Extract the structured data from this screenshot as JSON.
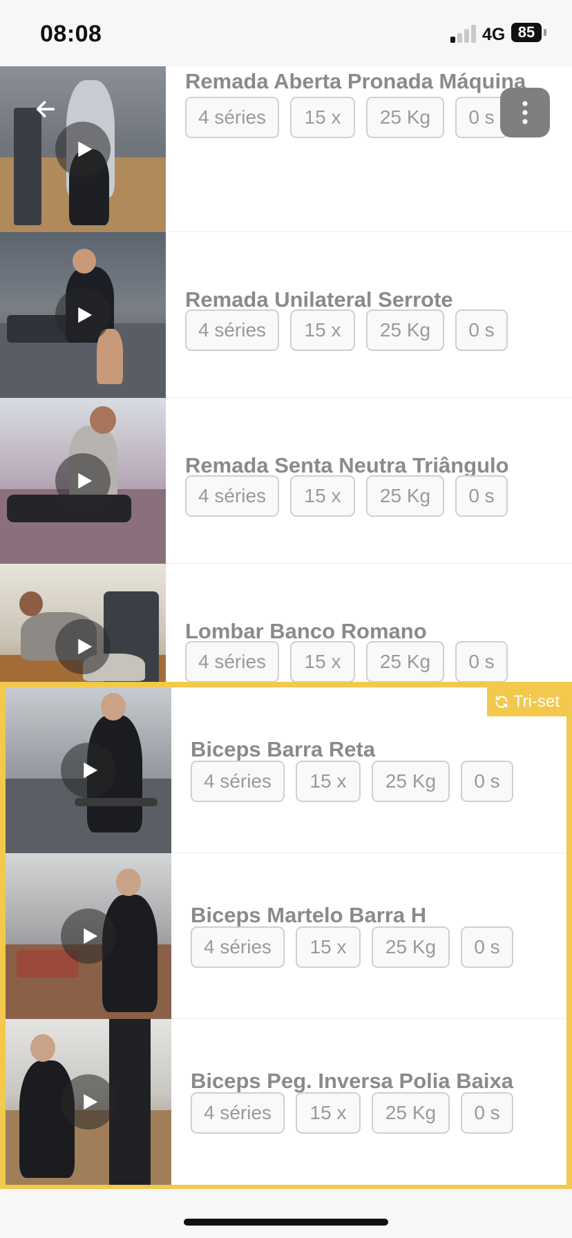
{
  "status": {
    "time": "08:08",
    "network": "4G",
    "battery": "85"
  },
  "exercises": [
    {
      "name": "Remada Aberta Pronada Máquina",
      "sets": "4 séries",
      "reps": "15 x",
      "weight": "25 Kg",
      "rest": "0 s"
    },
    {
      "name": "Remada Unilateral Serrote",
      "sets": "4 séries",
      "reps": "15 x",
      "weight": "25 Kg",
      "rest": "0 s"
    },
    {
      "name": "Remada Senta Neutra Triângulo",
      "sets": "4 séries",
      "reps": "15 x",
      "weight": "25 Kg",
      "rest": "0 s"
    },
    {
      "name": "Lombar Banco Romano",
      "sets": "4 séries",
      "reps": "15 x",
      "weight": "25 Kg",
      "rest": "0 s"
    }
  ],
  "triset": {
    "badge": "Tri-set",
    "accent": "#f2c94c",
    "exercises": [
      {
        "name": "Biceps Barra Reta",
        "sets": "4 séries",
        "reps": "15 x",
        "weight": "25 Kg",
        "rest": "0 s"
      },
      {
        "name": "Biceps Martelo Barra H",
        "sets": "4 séries",
        "reps": "15 x",
        "weight": "25 Kg",
        "rest": "0 s"
      },
      {
        "name": "Biceps Peg. Inversa Polia Baixa",
        "sets": "4 séries",
        "reps": "15 x",
        "weight": "25 Kg",
        "rest": "0 s"
      }
    ]
  },
  "icons": {
    "back": "arrow-left-icon",
    "menu": "more-vertical-icon",
    "play": "play-icon",
    "triset": "refresh-icon"
  }
}
